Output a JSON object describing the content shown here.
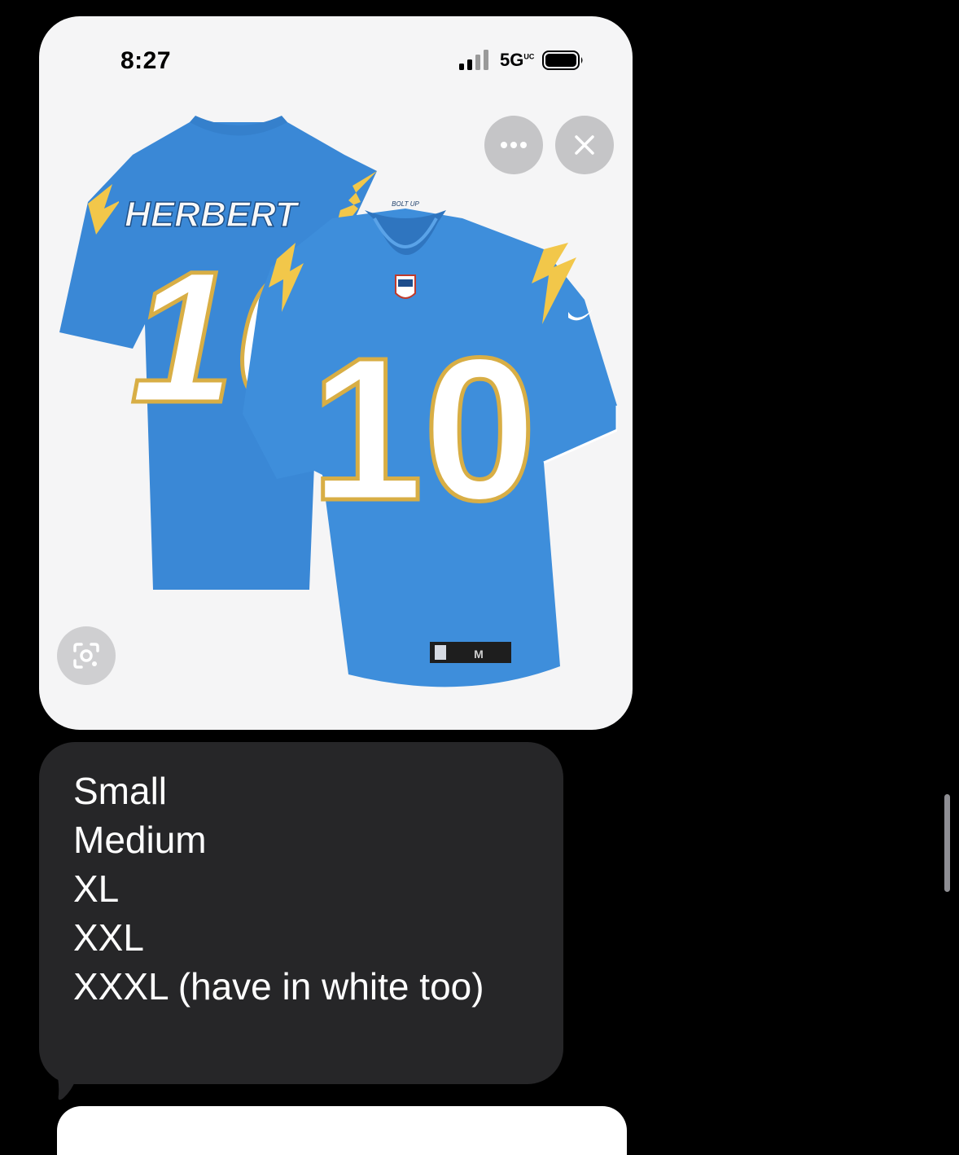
{
  "status_bar": {
    "time": "8:27",
    "network": "5G",
    "network_suffix": "UC"
  },
  "image_card": {
    "jersey": {
      "back_name": "HERBERT",
      "number": "10",
      "collar_text": "BOLT UP",
      "size_tag": "M"
    },
    "icons": {
      "more": "ellipsis-icon",
      "close": "close-icon",
      "lens": "visual-lookup-icon"
    }
  },
  "message": {
    "lines": [
      "Small",
      "Medium",
      "XL",
      "XXL",
      "XXXL (have in white too)"
    ]
  },
  "colors": {
    "jersey_blue": "#3e8edb",
    "bolt_yellow": "#f2c74a",
    "bubble_gray": "#262628",
    "card_bg": "#f5f5f6"
  }
}
